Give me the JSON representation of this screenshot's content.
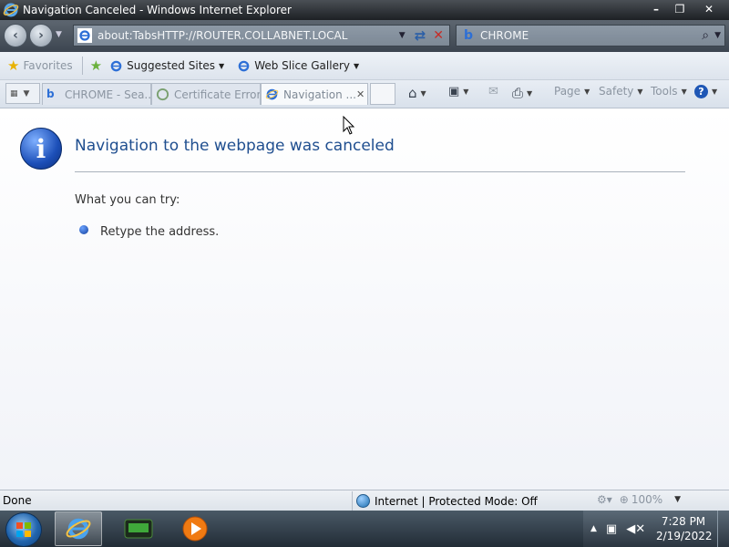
{
  "window": {
    "title": "Navigation Canceled - Windows Internet Explorer",
    "minimize": "–",
    "restore": "❐",
    "close": "✕"
  },
  "address_bar": {
    "url": "about:TabsHTTP://ROUTER.COLLABNET.LOCAL"
  },
  "search": {
    "value": "CHROME"
  },
  "favorites_bar": {
    "favorites_label": "Favorites",
    "suggested_sites_label": "Suggested Sites",
    "web_slice_gallery_label": "Web Slice Gallery"
  },
  "tabs": [
    {
      "label": "CHROME - Sea..."
    },
    {
      "label": "Certificate Error..."
    },
    {
      "label": "Navigation ..."
    }
  ],
  "command_bar": {
    "page_label": "Page",
    "safety_label": "Safety",
    "tools_label": "Tools"
  },
  "content": {
    "title": "Navigation to the webpage was canceled",
    "try_label": "What you can try:",
    "suggestions": [
      "Retype the address."
    ]
  },
  "status_bar": {
    "status_text": "Done",
    "zone_text": "Internet | Protected Mode: Off",
    "zoom_text": "100%"
  },
  "taskbar": {
    "time": "7:28 PM",
    "date": "2/19/2022"
  },
  "colors": {
    "title_blue": "#1f4e8f",
    "chrome_dark": "#1d2024"
  },
  "icons": [
    "ie-icon",
    "back-icon",
    "forward-icon",
    "refresh-icon",
    "stop-icon",
    "bing-icon",
    "search-icon",
    "star-icon",
    "home-icon",
    "rss-icon",
    "mail-icon",
    "print-icon",
    "help-icon",
    "info-icon",
    "globe-icon",
    "zoom-icon",
    "windows-start-icon",
    "media-player-icon"
  ]
}
